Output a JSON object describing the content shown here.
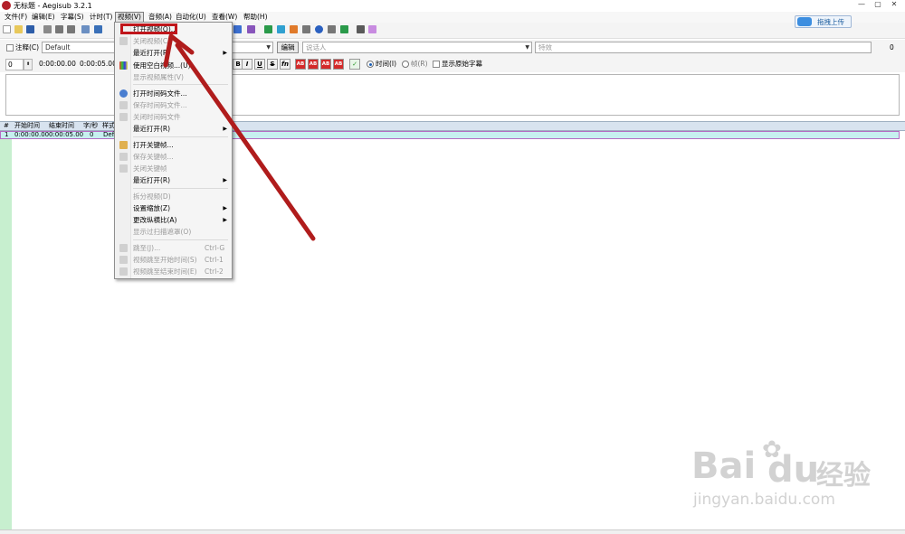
{
  "window": {
    "title": "无标题 - Aegisub 3.2.1",
    "minimize_glyph": "—",
    "maximize_glyph": "▢",
    "close_glyph": "✕"
  },
  "menubar": [
    {
      "label": "文件(F)"
    },
    {
      "label": "编辑(E)"
    },
    {
      "label": "字幕(S)"
    },
    {
      "label": "计时(T)"
    },
    {
      "label": "视频(V)"
    },
    {
      "label": "音频(A)"
    },
    {
      "label": "自动化(U)"
    },
    {
      "label": "查看(W)"
    },
    {
      "label": "帮助(H)"
    }
  ],
  "upload_button": {
    "label": "拖拽上传"
  },
  "style_row": {
    "comment_label": "注释(C)",
    "style_value": "Default",
    "edit_button": "编辑",
    "actor_placeholder": "说话人",
    "effect_placeholder": "特效",
    "margin_value": "0"
  },
  "time_row": {
    "layer_value": "0",
    "start_time": "0:00:00.00",
    "end_time": "0:00:05.00",
    "bold": "B",
    "italic": "I",
    "underline": "U",
    "strike": "S",
    "font": "fn",
    "color1": "AB",
    "color2": "AB",
    "color3": "AB",
    "color4": "AB",
    "time_radio": "时间(I)",
    "frame_radio": "帧(R)",
    "show_original": "显示原始字幕"
  },
  "grid": {
    "headers": [
      "#",
      "开始时间",
      "结束时间",
      "字/秒",
      "样式"
    ],
    "rows": [
      {
        "num": "1",
        "start": "0:00:00.00",
        "end": "0:00:05.00",
        "cps": "0",
        "style": "Defa"
      }
    ]
  },
  "video_menu": {
    "items": [
      {
        "label": "打开视频(O)...",
        "shortcut": "",
        "disabled": false
      },
      {
        "label": "关闭视频(C)",
        "shortcut": "",
        "disabled": true
      },
      {
        "label": "最近打开(R)",
        "shortcut": "",
        "disabled": false
      },
      {
        "label": "使用空白视频...(U)",
        "shortcut": "",
        "disabled": false
      },
      {
        "label": "显示视频属性(V)",
        "shortcut": "",
        "disabled": true
      },
      {
        "label": "打开时间码文件...",
        "shortcut": "",
        "disabled": false
      },
      {
        "label": "保存时间码文件...",
        "shortcut": "",
        "disabled": true
      },
      {
        "label": "关闭时间码文件",
        "shortcut": "",
        "disabled": true
      },
      {
        "label": "最近打开(R)",
        "shortcut": "",
        "disabled": false
      },
      {
        "label": "打开关键帧...",
        "shortcut": "",
        "disabled": false
      },
      {
        "label": "保存关键帧...",
        "shortcut": "",
        "disabled": true
      },
      {
        "label": "关闭关键帧",
        "shortcut": "",
        "disabled": true
      },
      {
        "label": "最近打开(R)",
        "shortcut": "",
        "disabled": false
      },
      {
        "label": "拆分视频(D)",
        "shortcut": "",
        "disabled": true
      },
      {
        "label": "设置缩放(Z)",
        "shortcut": "",
        "disabled": false
      },
      {
        "label": "更改纵横比(A)",
        "shortcut": "",
        "disabled": false
      },
      {
        "label": "显示过扫描遮罩(O)",
        "shortcut": "",
        "disabled": true
      },
      {
        "label": "跳至(J)...",
        "shortcut": "Ctrl-G",
        "disabled": true
      },
      {
        "label": "视频跳至开始时间(S)",
        "shortcut": "Ctrl-1",
        "disabled": true
      },
      {
        "label": "视频跳至结束时间(E)",
        "shortcut": "Ctrl-2",
        "disabled": true
      }
    ],
    "submenu_glyph": "▶"
  },
  "watermark": {
    "brand": "Bai",
    "brand2": "du",
    "cn": "经验",
    "url": "jingyan.baidu.com"
  },
  "colors": {
    "highlight": "#c0161b",
    "arrow": "#b01c1c",
    "grid_row": "#c7f0f0",
    "left_strip": "#c7efcf"
  }
}
